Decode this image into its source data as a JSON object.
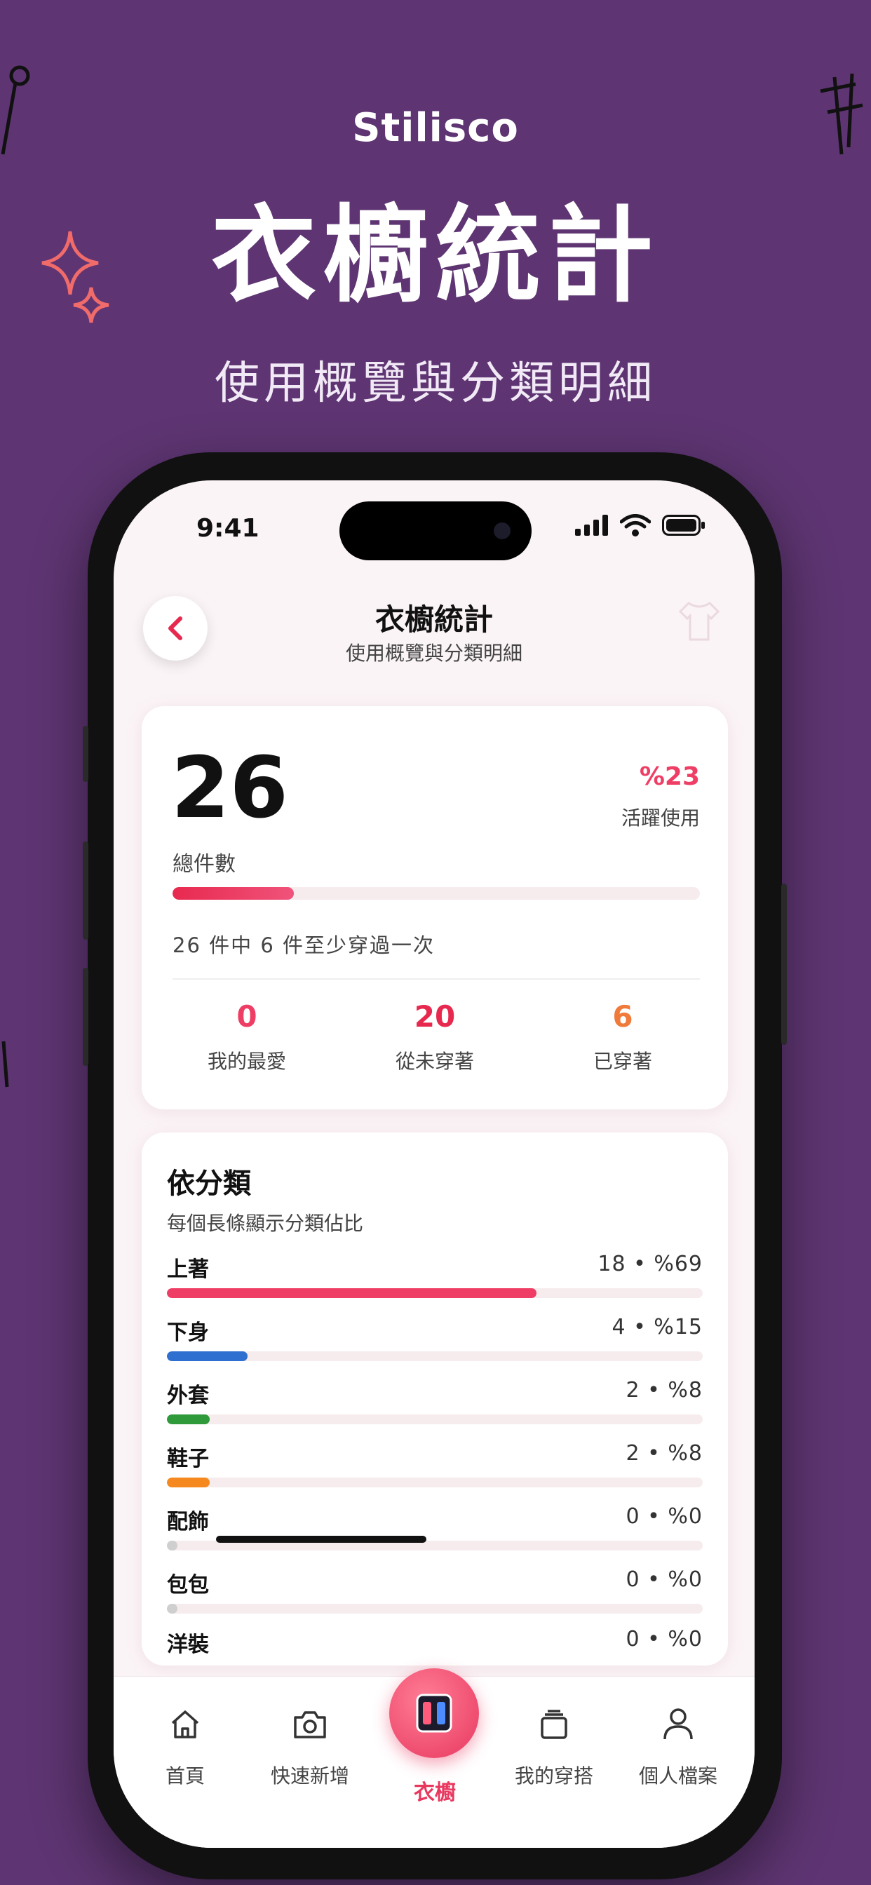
{
  "promo": {
    "brand": "Stilisco",
    "headline": "衣櫥統計",
    "subheadline": "使用概覽與分類明細"
  },
  "status_bar": {
    "time": "9:41"
  },
  "header": {
    "title": "衣櫥統計",
    "subtitle": "使用概覽與分類明細",
    "back_icon": "chevron-left-icon"
  },
  "summary": {
    "total": "26",
    "total_label": "總件數",
    "active_percent": "%23",
    "active_label": "活躍使用",
    "active_fraction": 0.23,
    "note": "26 件中 6 件至少穿過一次",
    "stats": [
      {
        "value": "0",
        "label": "我的最愛",
        "color": "#ef3e65"
      },
      {
        "value": "20",
        "label": "從未穿著",
        "color": "#e8294f"
      },
      {
        "value": "6",
        "label": "已穿著",
        "color": "#f07a3a"
      }
    ]
  },
  "categories": {
    "title": "依分類",
    "subtitle": "每個長條顯示分類佔比",
    "items": [
      {
        "name": "上著",
        "value": "18 • %69",
        "fraction": 0.69,
        "color": "#ef3e65"
      },
      {
        "name": "下身",
        "value": "4 • %15",
        "fraction": 0.15,
        "color": "#2f6fcf"
      },
      {
        "name": "外套",
        "value": "2 • %8",
        "fraction": 0.08,
        "color": "#2e9a3a"
      },
      {
        "name": "鞋子",
        "value": "2 • %8",
        "fraction": 0.08,
        "color": "#f5891f"
      },
      {
        "name": "配飾",
        "value": "0 • %0",
        "fraction": 0,
        "color": "#cfcfcf"
      },
      {
        "name": "包包",
        "value": "0 • %0",
        "fraction": 0,
        "color": "#cfcfcf"
      },
      {
        "name": "洋裝",
        "value": "0 • %0",
        "fraction": 0,
        "color": "#cfcfcf"
      }
    ]
  },
  "tabbar": {
    "items": [
      {
        "label": "首頁",
        "icon": "home-icon"
      },
      {
        "label": "快速新增",
        "icon": "camera-icon"
      },
      {
        "label": "衣櫥",
        "icon": "wardrobe-icon",
        "active": true
      },
      {
        "label": "我的穿搭",
        "icon": "outfits-icon"
      },
      {
        "label": "個人檔案",
        "icon": "profile-icon"
      }
    ]
  },
  "colors": {
    "background": "#5e3572",
    "accent": "#ef3e65"
  }
}
